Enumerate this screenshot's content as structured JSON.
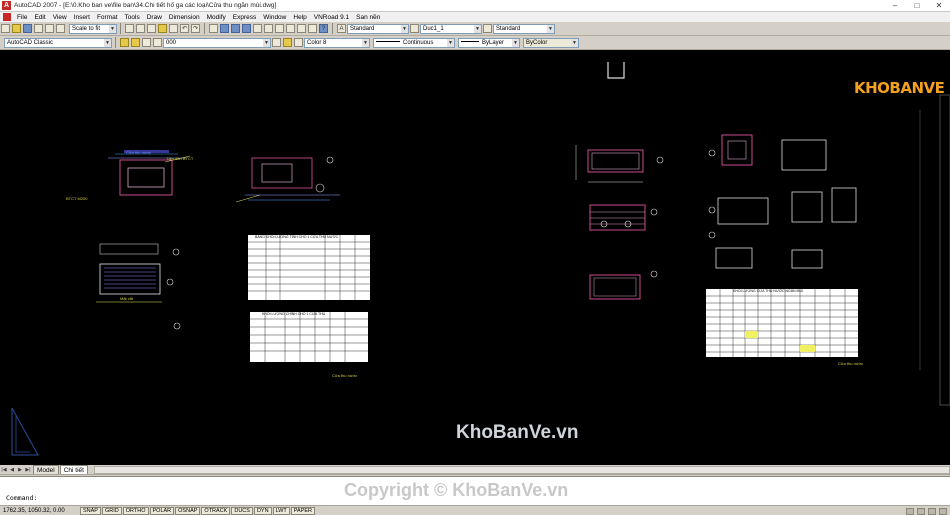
{
  "window": {
    "title": "AutoCAD 2007 - [E:\\0.Kho ban ve\\file ban\\34.Chi tiết hố ga các loại\\Cửa thu ngăn mùi.dwg]",
    "controls": [
      "–",
      "□",
      "✕"
    ]
  },
  "menu": [
    "File",
    "Edit",
    "View",
    "Insert",
    "Format",
    "Tools",
    "Draw",
    "Dimension",
    "Modify",
    "Express",
    "Window",
    "Help",
    "VNRoad 9.1",
    "San nền"
  ],
  "toolbar1": {
    "scale_combo": "Scale to fit",
    "text_style": "Standard",
    "dim_style": "Duc1_1",
    "table_style": "Standard"
  },
  "toolbar2": {
    "workspace": "AutoCAD Classic",
    "layer_state": "000",
    "color": "Color 8",
    "linetype": "Continuous",
    "lineweight": "ByLayer",
    "plotstyle": "ByColor"
  },
  "logo": {
    "text": "KHOBANVE"
  },
  "watermark": "KhoBanVe.vn",
  "tabs": [
    "Model",
    "Chi tiết"
  ],
  "active_tab": "Chi tiết",
  "command": {
    "prompt": "Command:",
    "watermark": "Copyright © KhoBanVe.vn"
  },
  "status": {
    "coords": "1762.35, 1050.32, 0.00",
    "buttons": [
      "SNAP",
      "GRID",
      "ORTHO",
      "POLAR",
      "OSNAP",
      "OTRACK",
      "DUCS",
      "DYN",
      "LWT",
      "PAPER"
    ]
  },
  "drawing_labels": {
    "cap_label": "Cửa thu nước",
    "lid_note": "Tấm đan BTCT",
    "cut_label": "Mặt cắt",
    "bttt": "BTCT M200",
    "table1_title": "BẢNG KHỐI LƯỢNG TÍNH CHO 1 CỬA THU NƯỚC",
    "table2_title": "KHỐI LƯỢNG CHÍNH CHO 1 CỬA THU",
    "table3_title": "KHỐI LƯỢNG CỬA THU NƯỚC NGĂN MÙI",
    "footer1": "Cửa thu nước",
    "footer2": "Cửa thu nước"
  }
}
